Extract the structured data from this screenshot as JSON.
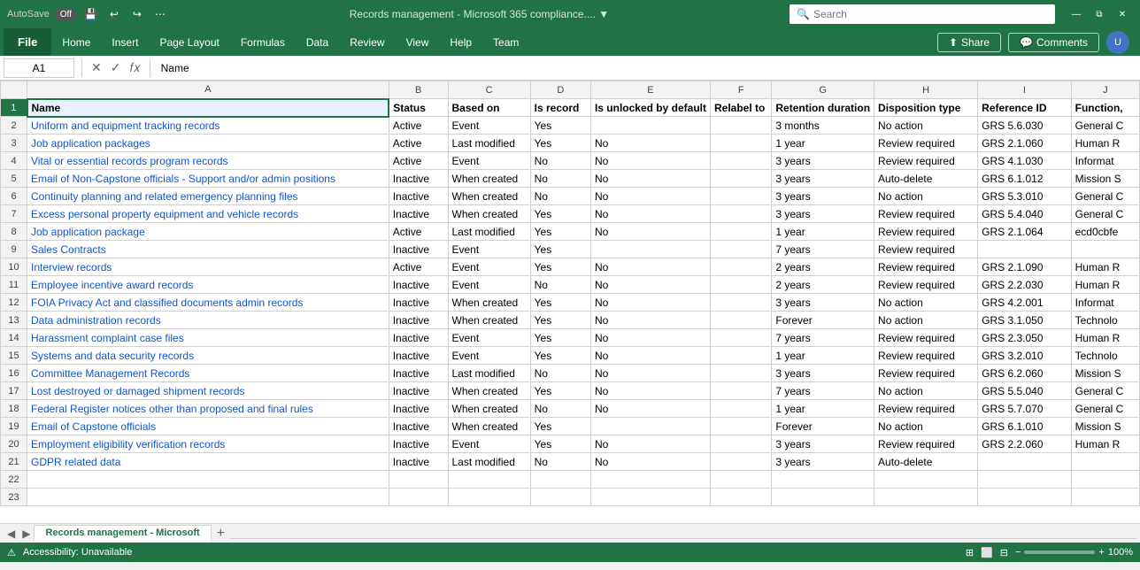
{
  "titleBar": {
    "autosave": "AutoSave",
    "autosaveState": "Off",
    "title": "Records management - Microsoft 365 compliance....  ▼",
    "searchPlaceholder": "Search",
    "undoIcon": "↩",
    "redoIcon": "↪"
  },
  "ribbon": {
    "file": "File",
    "tabs": [
      "Home",
      "Insert",
      "Page Layout",
      "Formulas",
      "Data",
      "Review",
      "View",
      "Help",
      "Team"
    ],
    "shareLabel": "Share",
    "commentsLabel": "Comments"
  },
  "formulaBar": {
    "nameBox": "A1",
    "formula": "Name"
  },
  "columns": [
    "",
    "A",
    "B",
    "C",
    "D",
    "E",
    "F",
    "G",
    "H",
    "I",
    "J"
  ],
  "rows": [
    [
      "Name",
      "Status",
      "Based on",
      "Is record",
      "Is unlocked by default",
      "Relabel to",
      "Retention duration",
      "Disposition type",
      "Reference ID",
      "Function,"
    ],
    [
      "Uniform and equipment tracking records",
      "Active",
      "Event",
      "Yes",
      "",
      "",
      "3 months",
      "No action",
      "GRS 5.6.030",
      "General C"
    ],
    [
      "Job application packages",
      "Active",
      "Last modified",
      "Yes",
      "No",
      "",
      "1 year",
      "Review required",
      "GRS 2.1.060",
      "Human R"
    ],
    [
      "Vital or essential records program records",
      "Active",
      "Event",
      "No",
      "No",
      "",
      "3 years",
      "Review required",
      "GRS 4.1.030",
      "Informat"
    ],
    [
      "Email of Non-Capstone officials - Support and/or admin positions",
      "Inactive",
      "When created",
      "No",
      "No",
      "",
      "3 years",
      "Auto-delete",
      "GRS 6.1.012",
      "Mission S"
    ],
    [
      "Continuity planning and related emergency planning files",
      "Inactive",
      "When created",
      "No",
      "No",
      "",
      "3 years",
      "No action",
      "GRS 5.3.010",
      "General C"
    ],
    [
      "Excess personal property equipment and vehicle records",
      "Inactive",
      "When created",
      "Yes",
      "No",
      "",
      "3 years",
      "Review required",
      "GRS 5.4.040",
      "General C"
    ],
    [
      "Job application package",
      "Active",
      "Last modified",
      "Yes",
      "No",
      "",
      "1 year",
      "Review required",
      "GRS 2.1.064",
      "ecd0cbfe"
    ],
    [
      "Sales Contracts",
      "Inactive",
      "Event",
      "Yes",
      "",
      "",
      "7 years",
      "Review required",
      "",
      ""
    ],
    [
      "Interview records",
      "Active",
      "Event",
      "Yes",
      "No",
      "",
      "2 years",
      "Review required",
      "GRS 2.1.090",
      "Human R"
    ],
    [
      "Employee incentive award records",
      "Inactive",
      "Event",
      "No",
      "No",
      "",
      "2 years",
      "Review required",
      "GRS 2.2.030",
      "Human R"
    ],
    [
      "FOIA Privacy Act and classified documents admin records",
      "Inactive",
      "When created",
      "Yes",
      "No",
      "",
      "3 years",
      "No action",
      "GRS 4.2.001",
      "Informat"
    ],
    [
      "Data administration records",
      "Inactive",
      "When created",
      "Yes",
      "No",
      "",
      "Forever",
      "No action",
      "GRS 3.1.050",
      "Technolo"
    ],
    [
      "Harassment complaint case files",
      "Inactive",
      "Event",
      "Yes",
      "No",
      "",
      "7 years",
      "Review required",
      "GRS 2.3.050",
      "Human R"
    ],
    [
      "Systems and data security records",
      "Inactive",
      "Event",
      "Yes",
      "No",
      "",
      "1 year",
      "Review required",
      "GRS 3.2.010",
      "Technolo"
    ],
    [
      "Committee Management Records",
      "Inactive",
      "Last modified",
      "No",
      "No",
      "",
      "3 years",
      "Review required",
      "GRS 6.2.060",
      "Mission S"
    ],
    [
      "Lost destroyed or damaged shipment records",
      "Inactive",
      "When created",
      "Yes",
      "No",
      "",
      "7 years",
      "No action",
      "GRS 5.5.040",
      "General C"
    ],
    [
      "Federal Register notices other than proposed and final rules",
      "Inactive",
      "When created",
      "No",
      "No",
      "",
      "1 year",
      "Review required",
      "GRS 5.7.070",
      "General C"
    ],
    [
      "Email of Capstone officials",
      "Inactive",
      "When created",
      "Yes",
      "",
      "",
      "Forever",
      "No action",
      "GRS 6.1.010",
      "Mission S"
    ],
    [
      "Employment eligibility verification records",
      "Inactive",
      "Event",
      "Yes",
      "No",
      "",
      "3 years",
      "Review required",
      "GRS 2.2.060",
      "Human R"
    ],
    [
      "GDPR related data",
      "Inactive",
      "Last modified",
      "No",
      "No",
      "",
      "3 years",
      "Auto-delete",
      "",
      ""
    ],
    [
      "",
      "",
      "",
      "",
      "",
      "",
      "",
      "",
      "",
      ""
    ],
    [
      "",
      "",
      "",
      "",
      "",
      "",
      "",
      "",
      "",
      ""
    ]
  ],
  "sheetTabs": {
    "tabs": [
      "Records management - Microsoft"
    ],
    "activeTab": "Records management - Microsoft"
  },
  "statusBar": {
    "accessibility": "Accessibility: Unavailable",
    "zoom": "100%"
  }
}
